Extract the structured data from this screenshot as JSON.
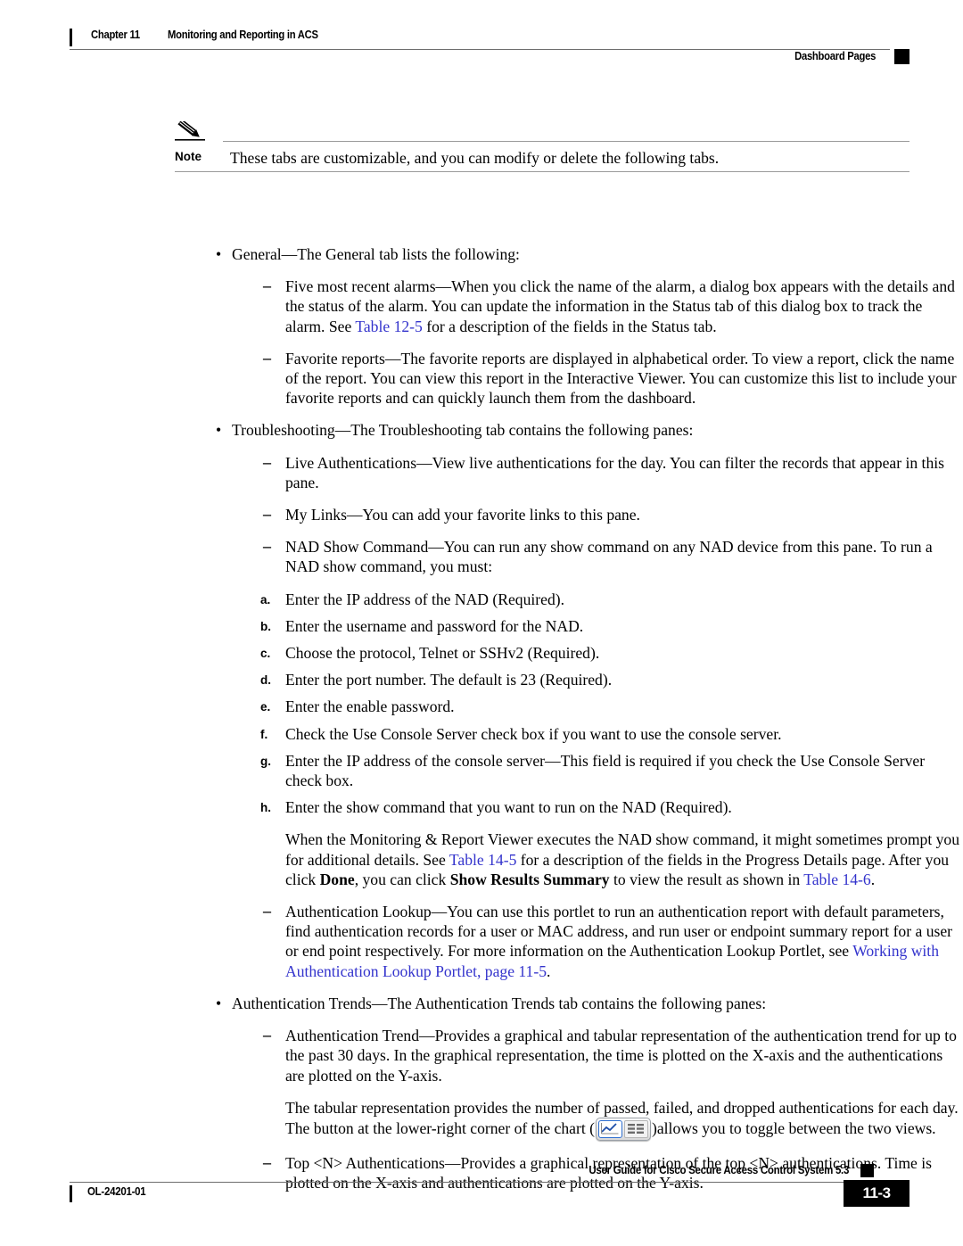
{
  "header": {
    "chapter": "Chapter 11",
    "chapter_title": "Monitoring and Reporting in ACS",
    "section": "Dashboard Pages"
  },
  "note": {
    "label": "Note",
    "text": "These tabs are customizable, and you can modify or delete the following tabs."
  },
  "body": {
    "general_bullet": "General—The General tab lists the following:",
    "alarms_item_a": "Five most recent alarms—When you click the name of the alarm, a dialog box appears with the details and the status of the alarm. You can update the information in the Status tab of this dialog box to track the alarm. See ",
    "alarms_link": "Table 12-5",
    "alarms_item_b": " for a description of the fields in the Status tab.",
    "favorite_reports": "Favorite reports—The favorite reports are displayed in alphabetical order. To view a report, click the name of the report. You can view this report in the Interactive Viewer. You can customize this list to include your favorite reports and can quickly launch them from the dashboard.",
    "troubleshooting_bullet": "Troubleshooting—The Troubleshooting tab contains the following panes:",
    "live_auth": "Live Authentications—View live authentications for the day. You can filter the records that appear in this pane.",
    "my_links": "My Links—You can add your favorite links to this pane.",
    "nad_show": "NAD Show Command—You can run any show command on any NAD device from this pane. To run a NAD show command, you must:",
    "steps": [
      {
        "letter": "a.",
        "text": "Enter the IP address of the NAD (Required)."
      },
      {
        "letter": "b.",
        "text": "Enter the username and password for the NAD."
      },
      {
        "letter": "c.",
        "text": "Choose the protocol, Telnet or SSHv2 (Required)."
      },
      {
        "letter": "d.",
        "text": "Enter the port number. The default is 23 (Required)."
      },
      {
        "letter": "e.",
        "text": "Enter the enable password."
      },
      {
        "letter": "f.",
        "text": "Check the Use Console Server check box if you want to use the console server."
      },
      {
        "letter": "g.",
        "text": "Enter the IP address of the console server—This field is required if you check the Use Console Server check box."
      },
      {
        "letter": "h.",
        "text": "Enter the show command that you want to run on the NAD (Required)."
      }
    ],
    "progress_para_a": "When the Monitoring & Report Viewer executes the NAD show command, it might sometimes prompt you for additional details. See ",
    "progress_link_1": "Table 14-5",
    "progress_para_b": " for a description of the fields in the Progress Details page. After you click ",
    "progress_bold_1": "Done",
    "progress_para_c": ", you can click ",
    "progress_bold_2": "Show Results Summary",
    "progress_para_d": " to view the result as shown in ",
    "progress_link_2": "Table 14-6",
    "progress_para_e": ".",
    "auth_lookup_a": "Authentication Lookup—You can use this portlet to run an authentication report with default parameters, find authentication records for a user or MAC address, and run user or endpoint summary report for a user or end point respectively. For more information on the Authentication Lookup Portlet, see ",
    "auth_lookup_link": "Working with Authentication Lookup Portlet, page 11-5",
    "auth_lookup_b": ".",
    "auth_trends_bullet": "Authentication Trends—The Authentication Trends tab contains the following panes:",
    "auth_trend_item": "Authentication Trend—Provides a graphical and tabular representation of the authentication trend for up to the past 30 days. In the graphical representation, the time is plotted on the X-axis and the authentications are plotted on the Y-axis.",
    "tabular_para_a": "The tabular representation provides the number of passed, failed, and dropped authentications for each day. The button at the lower-right corner of the chart (",
    "tabular_para_b": ")allows you to toggle between the two views.",
    "top_n": "Top <N> Authentications—Provides a graphical representation of the top <N> authentications. Time is plotted on the X-axis and authentications are plotted on the Y-axis.",
    "bullet_glyph": "•",
    "dash_glyph": "–"
  },
  "footer": {
    "guide": "User Guide for Cisco Secure Access Control System 5.3",
    "doc_id": "OL-24201-01",
    "page": "11-3"
  },
  "colors": {
    "link": "#3333cc",
    "rule": "#6e6e6e",
    "note_rule": "#9a9a9a"
  }
}
